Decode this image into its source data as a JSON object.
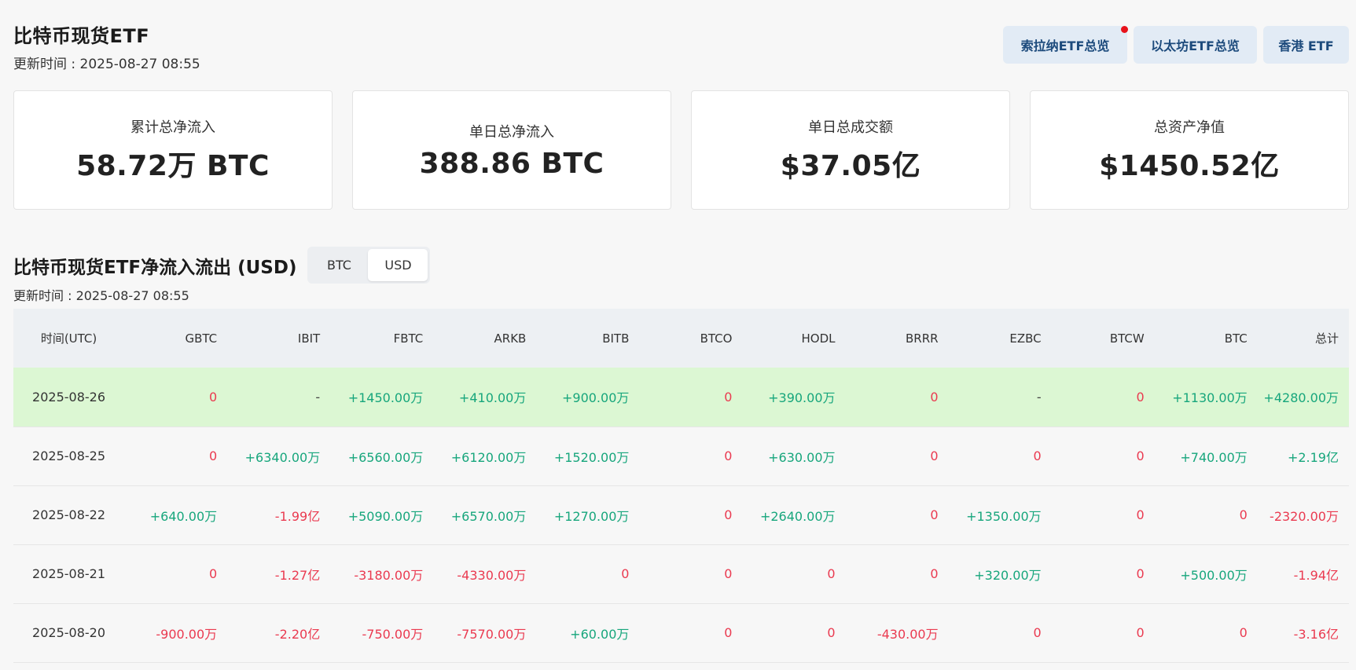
{
  "page": {
    "title": "比特币现货ETF",
    "update_time": "更新时间 : 2025-08-27 08:55"
  },
  "top_buttons": [
    {
      "label": "索拉纳ETF总览",
      "has_dot": true
    },
    {
      "label": "以太坊ETF总览"
    },
    {
      "label": "香港 ETF"
    }
  ],
  "cards": [
    {
      "label": "累计总净流入",
      "value": "58.72万 BTC"
    },
    {
      "label": "单日总净流入",
      "value": "388.86 BTC"
    },
    {
      "label": "单日总成交额",
      "value": "$37.05亿"
    },
    {
      "label": "总资产净值",
      "value": "$1450.52亿"
    }
  ],
  "section": {
    "title": "比特币现货ETF净流入流出 (USD)",
    "update_time": "更新时间 : 2025-08-27 08:55",
    "toggle": [
      "BTC",
      "USD"
    ],
    "toggle_active": "USD"
  },
  "table": {
    "columns": [
      "时间(UTC)",
      "GBTC",
      "IBIT",
      "FBTC",
      "ARKB",
      "BITB",
      "BTCO",
      "HODL",
      "BRRR",
      "EZBC",
      "BTCW",
      "BTC",
      "总计"
    ],
    "rows": [
      {
        "date": "2025-08-26",
        "highlight": true,
        "cells": [
          "0",
          "-",
          "+1450.00万",
          "+410.00万",
          "+900.00万",
          "0",
          "+390.00万",
          "0",
          "-",
          "0",
          "+1130.00万",
          "+4280.00万"
        ]
      },
      {
        "date": "2025-08-25",
        "cells": [
          "0",
          "+6340.00万",
          "+6560.00万",
          "+6120.00万",
          "+1520.00万",
          "0",
          "+630.00万",
          "0",
          "0",
          "0",
          "+740.00万",
          "+2.19亿"
        ]
      },
      {
        "date": "2025-08-22",
        "cells": [
          "+640.00万",
          "-1.99亿",
          "+5090.00万",
          "+6570.00万",
          "+1270.00万",
          "0",
          "+2640.00万",
          "0",
          "+1350.00万",
          "0",
          "0",
          "-2320.00万"
        ]
      },
      {
        "date": "2025-08-21",
        "cells": [
          "0",
          "-1.27亿",
          "-3180.00万",
          "-4330.00万",
          "0",
          "0",
          "0",
          "0",
          "+320.00万",
          "0",
          "+500.00万",
          "-1.94亿"
        ]
      },
      {
        "date": "2025-08-20",
        "cells": [
          "-900.00万",
          "-2.20亿",
          "-750.00万",
          "-7570.00万",
          "+60.00万",
          "0",
          "0",
          "-430.00万",
          "0",
          "0",
          "0",
          "-3.16亿"
        ]
      }
    ]
  },
  "colors": {
    "positive": "#17a67c",
    "negative": "#ea3a50",
    "highlight_row": "#dcf7d3",
    "button_bg": "#e2ebf5",
    "button_text": "#1c4a7c"
  }
}
